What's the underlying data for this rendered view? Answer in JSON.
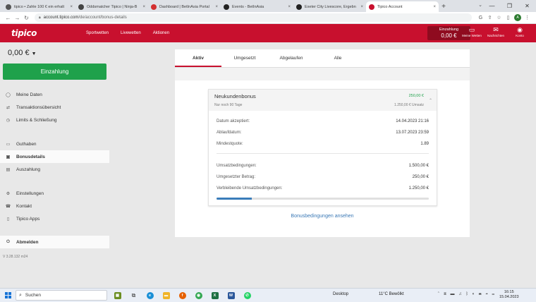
{
  "browser": {
    "tabs": [
      {
        "title": "tipico • Zahle 100 € ein erhalt",
        "fav_color": "#555",
        "fav_icon": "tipico-icon",
        "active": false
      },
      {
        "title": "Oddsmatcher Tipico | Ninja-B",
        "fav_color": "#444",
        "fav_icon": "oddsmatcher-icon",
        "active": false
      },
      {
        "title": "Dashboard | BetInAsia Portal",
        "fav_color": "#d32f2f",
        "fav_icon": "betinasia-icon",
        "active": false
      },
      {
        "title": "Events - BetInAsia",
        "fav_color": "#222",
        "fav_icon": "soccer-ball-icon",
        "active": false
      },
      {
        "title": "Exeter City Livescore, Ergebn",
        "fav_color": "#222",
        "fav_icon": "livescore-icon",
        "active": false
      },
      {
        "title": "Tipico Account",
        "fav_color": "#c8102e",
        "fav_icon": "tipico-icon",
        "active": true
      }
    ],
    "new_tab": "+",
    "url_host": "account.tipico.com",
    "url_path": "/de/account/bonus-details",
    "profile_letter": "A"
  },
  "header": {
    "logo": "tipico",
    "nav": [
      "Sportwetten",
      "Livewetten",
      "Aktionen"
    ],
    "deposit_label": "Einzahlung",
    "deposit_amount": "0,00 €",
    "icons": [
      {
        "label": "Meine Wetten",
        "icon": "bets-icon",
        "glyph": "▭"
      },
      {
        "label": "Nachrichten",
        "icon": "mail-icon",
        "glyph": "✉"
      },
      {
        "label": "Konto",
        "icon": "account-icon",
        "glyph": "◉"
      }
    ]
  },
  "sidebar": {
    "balance": "0,00 €",
    "deposit_button": "Einzahlung",
    "items": [
      {
        "label": "Meine Daten",
        "icon": "user-icon",
        "glyph": "◯"
      },
      {
        "label": "Transaktionsübersicht",
        "icon": "transactions-icon",
        "glyph": "⇄"
      },
      {
        "label": "Limits & Schließung",
        "icon": "limits-icon",
        "glyph": "◷"
      },
      {
        "label": "Guthaben",
        "icon": "wallet-icon",
        "glyph": "▭"
      },
      {
        "label": "Bonusdetails",
        "icon": "bonus-icon",
        "glyph": "▣",
        "active": true
      },
      {
        "label": "Auszahlung",
        "icon": "withdraw-icon",
        "glyph": "▤"
      },
      {
        "label": "Einstellungen",
        "icon": "settings-icon",
        "glyph": "⚙"
      },
      {
        "label": "Kontakt",
        "icon": "contact-icon",
        "glyph": "☎"
      },
      {
        "label": "Tipico Apps",
        "icon": "apps-icon",
        "glyph": "▯"
      },
      {
        "label": "Abmelden",
        "icon": "logout-icon",
        "glyph": "⏻"
      }
    ],
    "version": "V 3.28.132 m24"
  },
  "main": {
    "tabs": [
      "Aktiv",
      "Umgesetzt",
      "Abgelaufen",
      "Alle"
    ],
    "active_tab": 0,
    "bonus": {
      "name": "Neukundenbonus",
      "subtitle": "Nur noch 90 Tage",
      "amount": "250,00 €",
      "turnover": "1.250,00 € Umsatz",
      "rows": [
        {
          "label": "Datum akzeptiert:",
          "value": "14.04.2023 21:16"
        },
        {
          "label": "Ablaufdatum:",
          "value": "13.07.2023 23:59"
        },
        {
          "label": "Mindestquote:",
          "value": "1.89"
        },
        {
          "label": "Umsatzbedingungen:",
          "value": "1.500,00 €"
        },
        {
          "label": "Umgesetzter Betrag:",
          "value": "250,00 €"
        },
        {
          "label": "Verbleibende Umsatzbedingungen:",
          "value": "1.250,00 €"
        }
      ],
      "progress_fraction": 0.167
    },
    "terms_link": "Bonusbedingungen ansehen"
  },
  "taskbar": {
    "search": "Suchen",
    "desktop": "Desktop",
    "weather": "11°C  Bewölkt",
    "time": "16:15",
    "date": "15.04.2023"
  },
  "colors": {
    "brand": "#c8102e",
    "deposit": "#1fa14b",
    "link": "#3a78b5"
  }
}
